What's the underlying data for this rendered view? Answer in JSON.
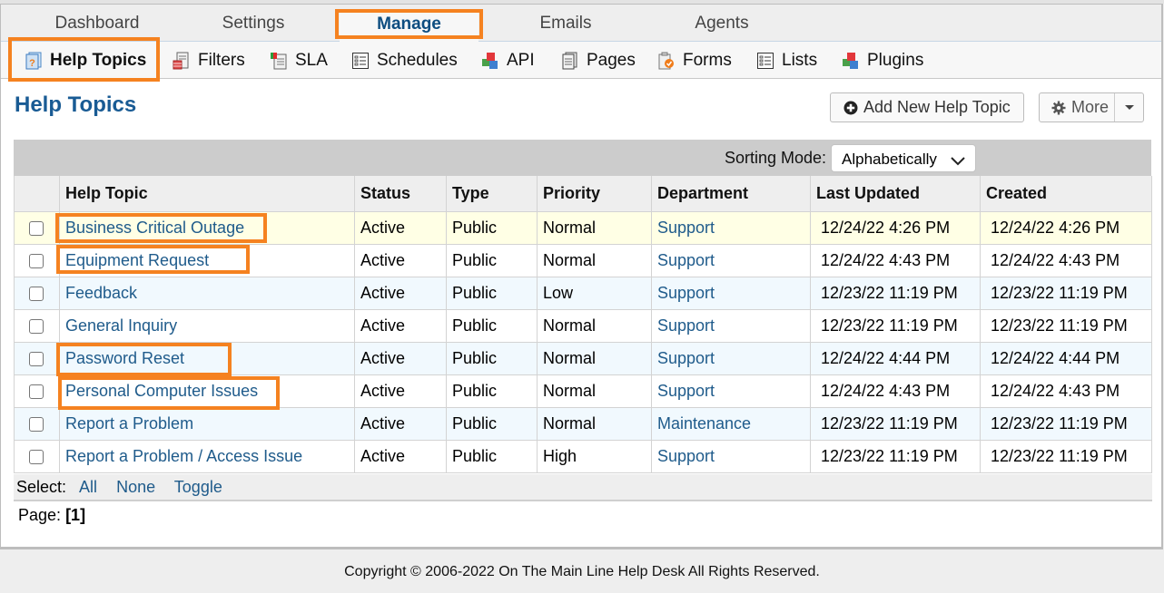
{
  "nav": {
    "tabs": [
      {
        "label": "Dashboard",
        "active": false
      },
      {
        "label": "Settings",
        "active": false
      },
      {
        "label": "Manage",
        "active": true
      },
      {
        "label": "Emails",
        "active": false
      },
      {
        "label": "Agents",
        "active": false
      }
    ]
  },
  "subnav": {
    "items": [
      {
        "label": "Help Topics",
        "icon": "help-topics-icon",
        "active": true
      },
      {
        "label": "Filters",
        "icon": "filters-icon",
        "active": false
      },
      {
        "label": "SLA",
        "icon": "sla-icon",
        "active": false
      },
      {
        "label": "Schedules",
        "icon": "schedules-icon",
        "active": false
      },
      {
        "label": "API",
        "icon": "api-cubes-icon",
        "active": false
      },
      {
        "label": "Pages",
        "icon": "pages-icon",
        "active": false
      },
      {
        "label": "Forms",
        "icon": "forms-icon",
        "active": false
      },
      {
        "label": "Lists",
        "icon": "lists-icon",
        "active": false
      },
      {
        "label": "Plugins",
        "icon": "plugins-cubes-icon",
        "active": false
      }
    ]
  },
  "page": {
    "title": "Help Topics",
    "add_button": "Add New Help Topic",
    "more_button": "More"
  },
  "sorting": {
    "label": "Sorting Mode:",
    "selected": "Alphabetically"
  },
  "table": {
    "columns": [
      "Help Topic",
      "Status",
      "Type",
      "Priority",
      "Department",
      "Last Updated",
      "Created"
    ],
    "rows": [
      {
        "topic": "Business Critical Outage",
        "status": "Active",
        "type": "Public",
        "priority": "Normal",
        "department": "Support",
        "updated": "12/24/22 4:26 PM",
        "created": "12/24/22 4:26 PM"
      },
      {
        "topic": "Equipment Request",
        "status": "Active",
        "type": "Public",
        "priority": "Normal",
        "department": "Support",
        "updated": "12/24/22 4:43 PM",
        "created": "12/24/22 4:43 PM"
      },
      {
        "topic": "Feedback",
        "status": "Active",
        "type": "Public",
        "priority": "Low",
        "department": "Support",
        "updated": "12/23/22 11:19 PM",
        "created": "12/23/22 11:19 PM"
      },
      {
        "topic": "General Inquiry",
        "status": "Active",
        "type": "Public",
        "priority": "Normal",
        "department": "Support",
        "updated": "12/23/22 11:19 PM",
        "created": "12/23/22 11:19 PM"
      },
      {
        "topic": "Password Reset",
        "status": "Active",
        "type": "Public",
        "priority": "Normal",
        "department": "Support",
        "updated": "12/24/22 4:44 PM",
        "created": "12/24/22 4:44 PM"
      },
      {
        "topic": "Personal Computer Issues",
        "status": "Active",
        "type": "Public",
        "priority": "Normal",
        "department": "Support",
        "updated": "12/24/22 4:43 PM",
        "created": "12/24/22 4:43 PM"
      },
      {
        "topic": "Report a Problem",
        "status": "Active",
        "type": "Public",
        "priority": "Normal",
        "department": "Maintenance",
        "updated": "12/23/22 11:19 PM",
        "created": "12/23/22 11:19 PM"
      },
      {
        "topic": "Report a Problem / Access Issue",
        "status": "Active",
        "type": "Public",
        "priority": "High",
        "department": "Support",
        "updated": "12/23/22 11:19 PM",
        "created": "12/23/22 11:19 PM"
      }
    ]
  },
  "select": {
    "label": "Select:",
    "all": "All",
    "none": "None",
    "toggle": "Toggle"
  },
  "pagination": {
    "label": "Page:",
    "current": "[1]"
  },
  "footer": {
    "copyright": "Copyright © 2006-2022 On The Main Line Help Desk All Rights Reserved."
  },
  "colors": {
    "highlight": "#f58220",
    "title": "#195b94",
    "link": "#1f5b8b"
  }
}
